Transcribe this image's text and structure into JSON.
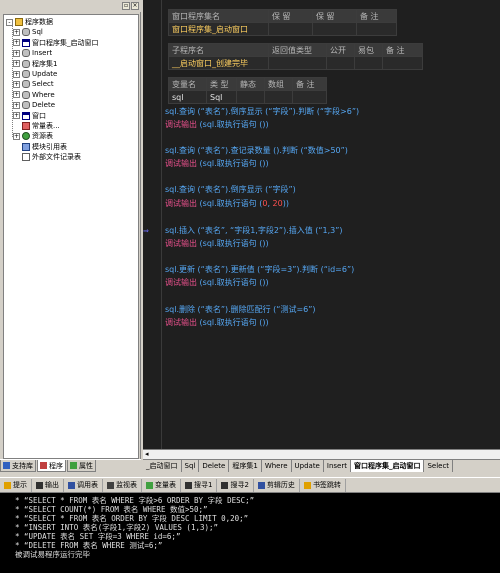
{
  "left_panel": {
    "tree": [
      {
        "label": "程序数据",
        "expander": "-",
        "icon": "folder",
        "level": 0
      },
      {
        "label": "Sql",
        "expander": "+",
        "icon": "db",
        "level": 1
      },
      {
        "label": "窗口程序集_启动窗口",
        "expander": "+",
        "icon": "win",
        "level": 1
      },
      {
        "label": "Insert",
        "expander": "+",
        "icon": "db",
        "level": 1
      },
      {
        "label": "程序集1",
        "expander": "+",
        "icon": "db",
        "level": 1
      },
      {
        "label": "Update",
        "expander": "+",
        "icon": "db",
        "level": 1
      },
      {
        "label": "Select",
        "expander": "+",
        "icon": "db",
        "level": 1
      },
      {
        "label": "Where",
        "expander": "+",
        "icon": "db",
        "level": 1
      },
      {
        "label": "Delete",
        "expander": "+",
        "icon": "db",
        "level": 1
      },
      {
        "label": "窗口",
        "expander": "+",
        "icon": "win",
        "level": 1
      },
      {
        "label": "常量表...",
        "expander": "",
        "icon": "const",
        "level": 1
      },
      {
        "label": "资源表",
        "expander": "+",
        "icon": "res",
        "level": 1
      },
      {
        "label": "模块引用表",
        "expander": "",
        "icon": "mod",
        "level": 1
      },
      {
        "label": "外部文件记录表",
        "expander": "",
        "icon": "file",
        "level": 1
      }
    ],
    "tabs": [
      "支持库",
      "程序",
      "属性"
    ],
    "active_tab": 1
  },
  "editor": {
    "table1": {
      "headers": [
        "窗口程序集名",
        "保 留",
        "保 留",
        "备 注"
      ],
      "values": [
        "窗口程序集_启动窗口",
        "",
        "",
        ""
      ]
    },
    "table2": {
      "headers": [
        "子程序名",
        "返回值类型",
        "公开",
        "易包",
        "备 注"
      ],
      "values": [
        "__启动窗口_创建完毕",
        "",
        "",
        "",
        ""
      ]
    },
    "table3": {
      "headers": [
        "变量名",
        "类 型",
        "静态",
        "数组",
        "备 注"
      ],
      "values": [
        "sql",
        "Sql",
        "",
        "",
        ""
      ]
    },
    "code": [
      {
        "call": "sql.查询",
        "args": " (“表名”).倒序显示 (“字段”).判断 (“字段>6”)"
      },
      {
        "call": "调试输出",
        "args": " (sql.取执行语句 ())"
      },
      {
        "call": "sql.查询",
        "args": " (“表名”).查记录数量 ().判断 (“数值>50”)"
      },
      {
        "call": "调试输出",
        "args": " (sql.取执行语句 ())"
      },
      {
        "call": "sql.查询",
        "args": " (“表名”).倒序显示 (“字段”)"
      },
      {
        "call": "调试输出",
        "args": " (sql.取执行语句 (",
        "num1": "0",
        "sep": ", ",
        "num2": "20",
        "tail": "))"
      },
      {
        "call": "sql.插入",
        "args": " (“表名”, “字段1,字段2”).插入值 (“1,3”)"
      },
      {
        "call": "调试输出",
        "args": " (sql.取执行语句 ())"
      },
      {
        "call": "sql.更新",
        "args": " (“表名”).更新值 (“字段=3”).判断 (“id=6”)"
      },
      {
        "call": "调试输出",
        "args": " (sql.取执行语句 ())"
      },
      {
        "call": "sql.删除",
        "args": " (“表名”).删除匹配行 (“测试=6”)"
      },
      {
        "call": "调试输出",
        "args": " (sql.取执行语句 ())"
      }
    ],
    "gutter_mark": "⇒"
  },
  "file_tabs": [
    "_启动窗口",
    "Sql",
    "Delete",
    "程序集1",
    "Where",
    "Update",
    "Insert",
    "窗口程序集_启动窗口",
    "Select"
  ],
  "active_file_tab": 7,
  "bottom_toolbar": [
    "提示",
    "输出",
    "调用表",
    "监视表",
    "变量表",
    "搜寻1",
    "搜寻2",
    "剪辑历史",
    "书签跳转"
  ],
  "output": {
    "lines": [
      "* “SELECT * FROM 表名 WHERE 字段>6 ORDER BY 字段 DESC;”",
      "* “SELECT COUNT(*) FROM 表名 WHERE 数值>50;”",
      "* “SELECT * FROM 表名 ORDER BY 字段 DESC LIMIT 0,20;”",
      "* “INSERT INTO 表名(字段1,字段2) VALUES (1,3);”",
      "* “UPDATE 表名 SET 字段=3 WHERE id=6;”",
      "* “DELETE FROM 表名 WHERE 测试=6;”"
    ],
    "status": "被调试易程序运行完毕"
  },
  "colors": {
    "editor_bg": "#1f1f1f",
    "code_call": "#56a8f5",
    "code_debug": "#e8508c",
    "code_string": "#e8d44d",
    "code_number": "#ff5050"
  }
}
